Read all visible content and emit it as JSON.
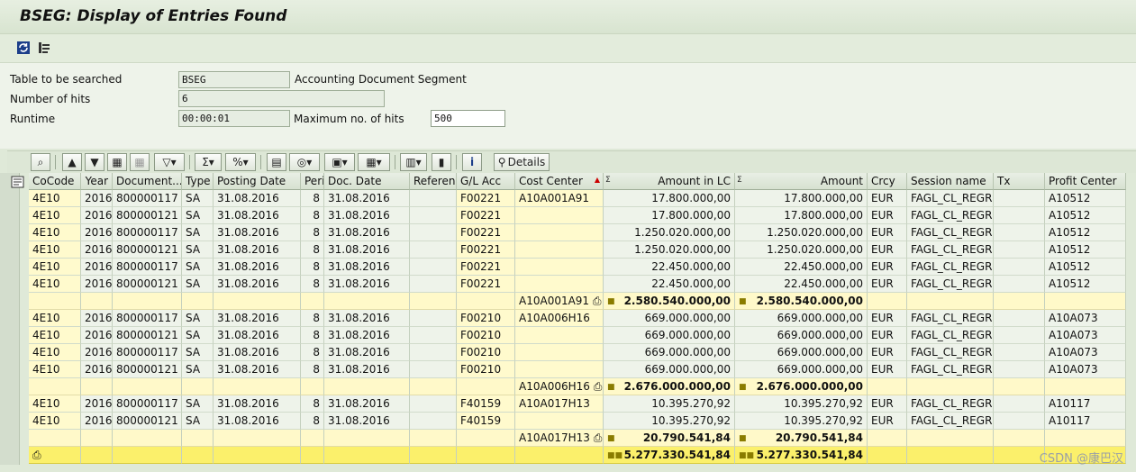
{
  "window": {
    "title": "BSEG: Display of Entries Found"
  },
  "form": {
    "table_label": "Table to be searched",
    "table_value": "BSEG",
    "table_desc": "Accounting Document Segment",
    "hits_label": "Number of hits",
    "hits_value": "6",
    "runtime_label": "Runtime",
    "runtime_value": "00:00:01",
    "maxhits_label": "Maximum no. of hits",
    "maxhits_value": "500"
  },
  "grid_toolbar": {
    "details_label": "Details"
  },
  "columns": [
    "CoCode",
    "Year",
    "Document...",
    "Type",
    "Posting Date",
    "Peri...",
    "Doc. Date",
    "Reference",
    "G/L Acc",
    "Cost Center",
    "Amount in LC",
    "Amount",
    "Crcy",
    "Session name",
    "Tx",
    "Profit Center"
  ],
  "rows": [
    [
      "4E10",
      "2016",
      "800000117",
      "SA",
      "31.08.2016",
      "8",
      "31.08.2016",
      "",
      "F00221",
      "A10A001A91",
      "17.800.000,00",
      "17.800.000,00",
      "EUR",
      "FAGL_CL_REGR",
      "",
      "A10512"
    ],
    [
      "4E10",
      "2016",
      "800000121",
      "SA",
      "31.08.2016",
      "8",
      "31.08.2016",
      "",
      "F00221",
      "",
      "17.800.000,00",
      "17.800.000,00",
      "EUR",
      "FAGL_CL_REGR",
      "",
      "A10512"
    ],
    [
      "4E10",
      "2016",
      "800000117",
      "SA",
      "31.08.2016",
      "8",
      "31.08.2016",
      "",
      "F00221",
      "",
      "1.250.020.000,00",
      "1.250.020.000,00",
      "EUR",
      "FAGL_CL_REGR",
      "",
      "A10512"
    ],
    [
      "4E10",
      "2016",
      "800000121",
      "SA",
      "31.08.2016",
      "8",
      "31.08.2016",
      "",
      "F00221",
      "",
      "1.250.020.000,00",
      "1.250.020.000,00",
      "EUR",
      "FAGL_CL_REGR",
      "",
      "A10512"
    ],
    [
      "4E10",
      "2016",
      "800000117",
      "SA",
      "31.08.2016",
      "8",
      "31.08.2016",
      "",
      "F00221",
      "",
      "22.450.000,00",
      "22.450.000,00",
      "EUR",
      "FAGL_CL_REGR",
      "",
      "A10512"
    ],
    [
      "4E10",
      "2016",
      "800000121",
      "SA",
      "31.08.2016",
      "8",
      "31.08.2016",
      "",
      "F00221",
      "",
      "22.450.000,00",
      "22.450.000,00",
      "EUR",
      "FAGL_CL_REGR",
      "",
      "A10512"
    ],
    [
      "SUM",
      "A10A001A91",
      "2.580.540.000,00",
      "2.580.540.000,00"
    ],
    [
      "4E10",
      "2016",
      "800000117",
      "SA",
      "31.08.2016",
      "8",
      "31.08.2016",
      "",
      "F00210",
      "A10A006H16",
      "669.000.000,00",
      "669.000.000,00",
      "EUR",
      "FAGL_CL_REGR",
      "",
      "A10A073"
    ],
    [
      "4E10",
      "2016",
      "800000121",
      "SA",
      "31.08.2016",
      "8",
      "31.08.2016",
      "",
      "F00210",
      "",
      "669.000.000,00",
      "669.000.000,00",
      "EUR",
      "FAGL_CL_REGR",
      "",
      "A10A073"
    ],
    [
      "4E10",
      "2016",
      "800000117",
      "SA",
      "31.08.2016",
      "8",
      "31.08.2016",
      "",
      "F00210",
      "",
      "669.000.000,00",
      "669.000.000,00",
      "EUR",
      "FAGL_CL_REGR",
      "",
      "A10A073"
    ],
    [
      "4E10",
      "2016",
      "800000121",
      "SA",
      "31.08.2016",
      "8",
      "31.08.2016",
      "",
      "F00210",
      "",
      "669.000.000,00",
      "669.000.000,00",
      "EUR",
      "FAGL_CL_REGR",
      "",
      "A10A073"
    ],
    [
      "SUM",
      "A10A006H16",
      "2.676.000.000,00",
      "2.676.000.000,00"
    ],
    [
      "4E10",
      "2016",
      "800000117",
      "SA",
      "31.08.2016",
      "8",
      "31.08.2016",
      "",
      "F40159",
      "A10A017H13",
      "10.395.270,92",
      "10.395.270,92",
      "EUR",
      "FAGL_CL_REGR",
      "",
      "A10117"
    ],
    [
      "4E10",
      "2016",
      "800000121",
      "SA",
      "31.08.2016",
      "8",
      "31.08.2016",
      "",
      "F40159",
      "",
      "10.395.270,92",
      "10.395.270,92",
      "EUR",
      "FAGL_CL_REGR",
      "",
      "A10117"
    ],
    [
      "SUM",
      "A10A017H13",
      "20.790.541,84",
      "20.790.541,84"
    ],
    [
      "TOTAL",
      "5.277.330.541,84",
      "5.277.330.541,84"
    ]
  ],
  "watermark": "CSDN @康巴汉"
}
